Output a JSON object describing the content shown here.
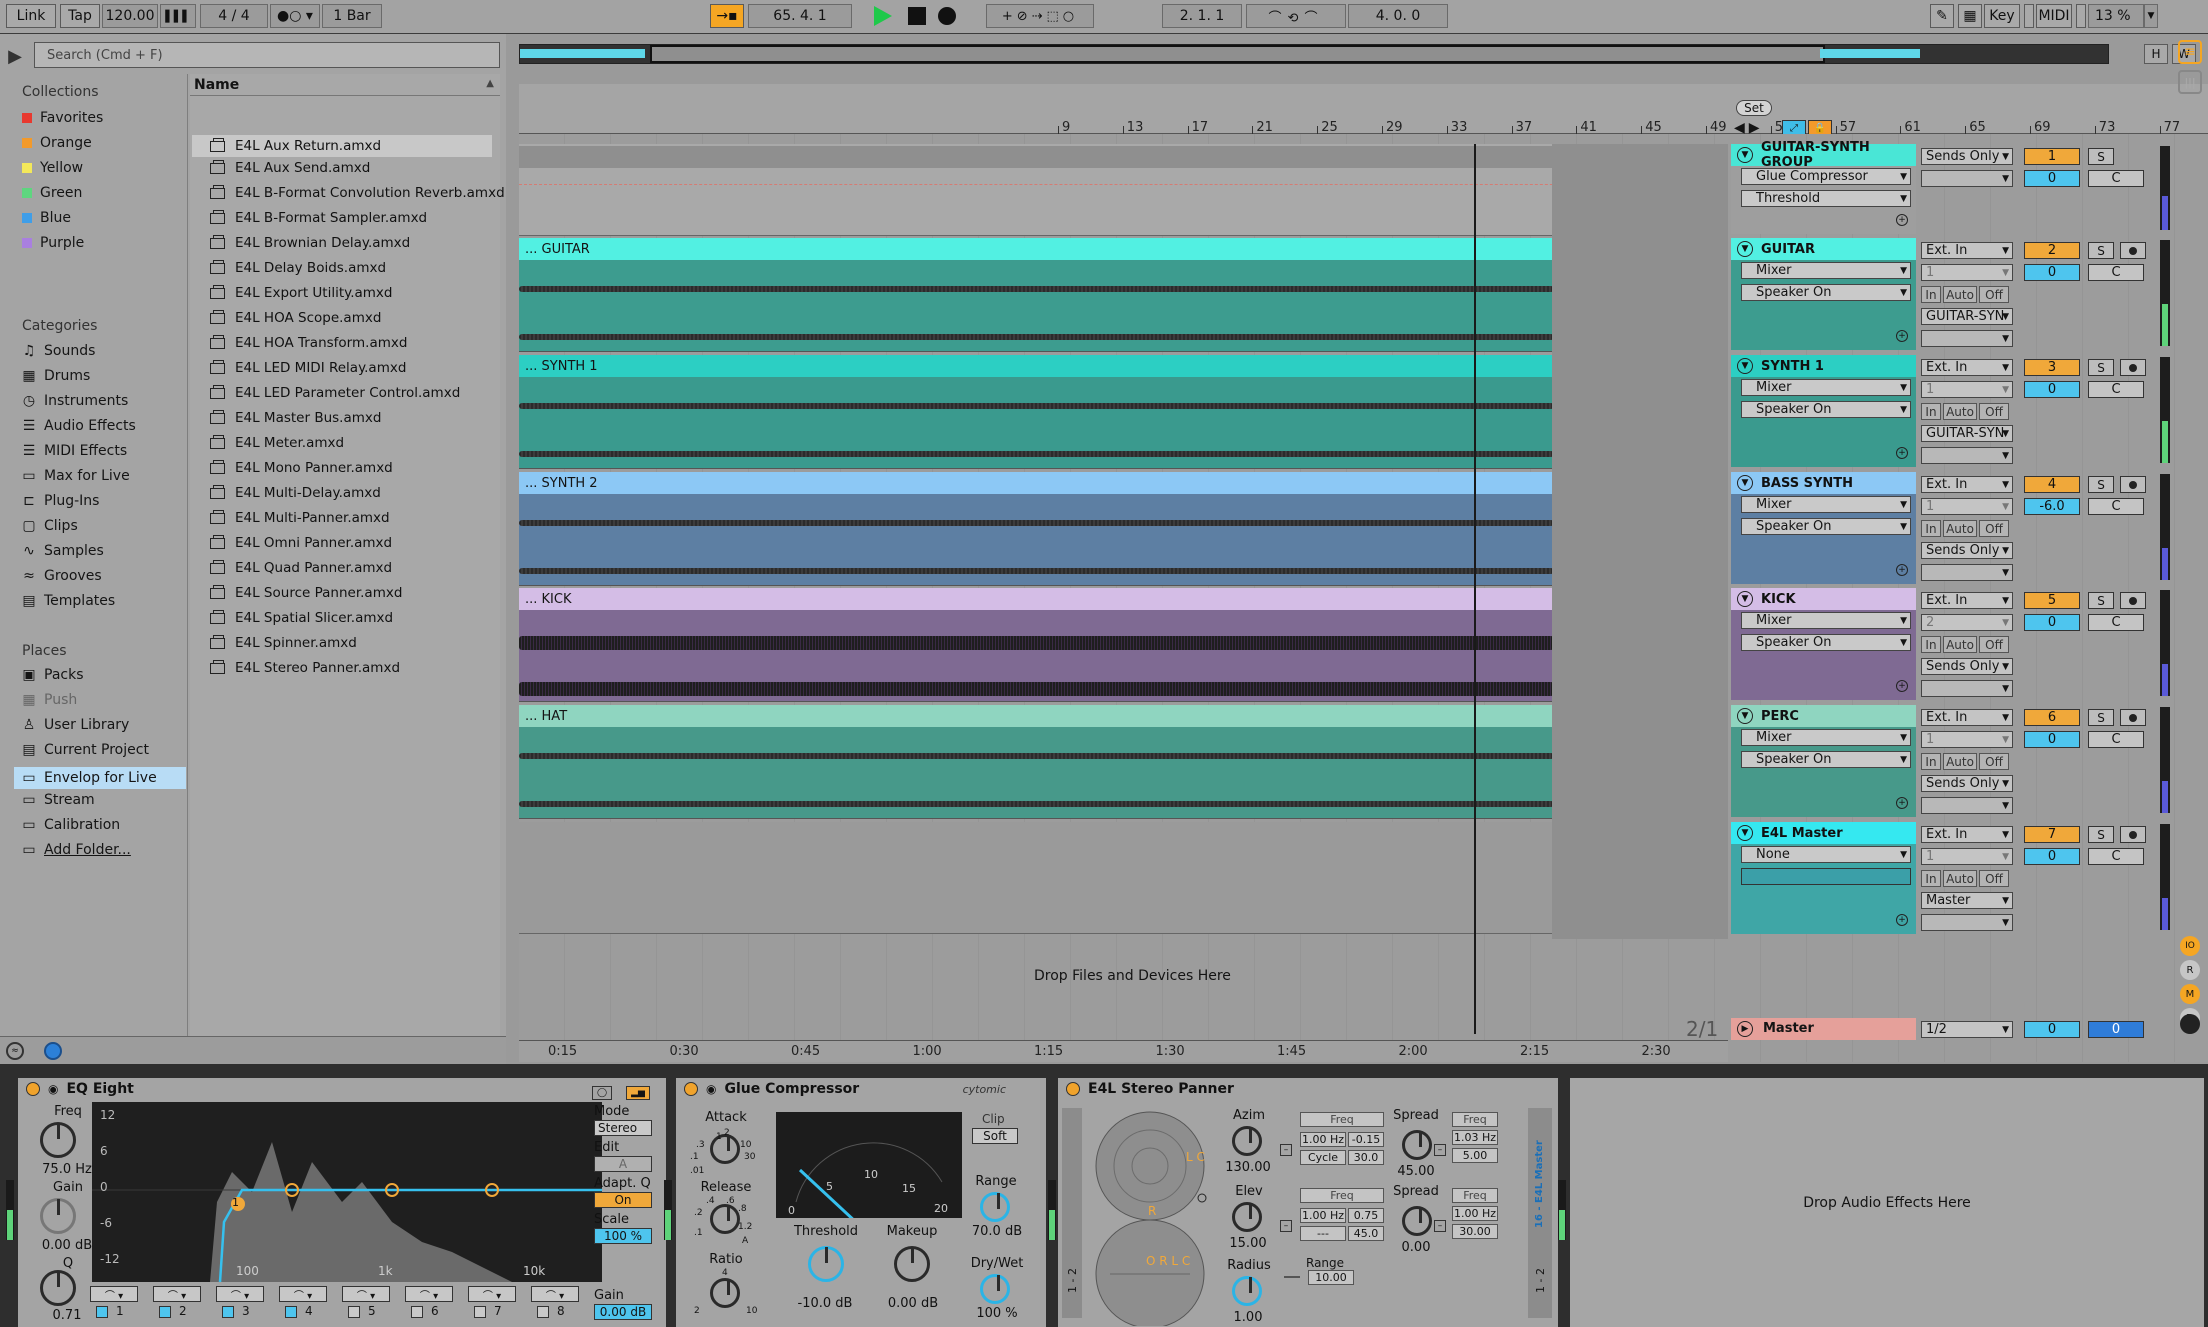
{
  "transport": {
    "link": "Link",
    "tap": "Tap",
    "tempo": "120.00",
    "signature": "4 / 4",
    "quantize": "1 Bar",
    "position": "65.  4.  1",
    "loop_start": "2.  1.  1",
    "loop_length": "4.  0.  0",
    "key": "Key",
    "midi": "MIDI",
    "cpu": "13 %"
  },
  "browser": {
    "search_placeholder": "Search (Cmd + F)",
    "collections_title": "Collections",
    "collections": [
      {
        "label": "Favorites",
        "color": "#e8392f"
      },
      {
        "label": "Orange",
        "color": "#f39a2b"
      },
      {
        "label": "Yellow",
        "color": "#f3e85a"
      },
      {
        "label": "Green",
        "color": "#5ed67f"
      },
      {
        "label": "Blue",
        "color": "#3f9ee8"
      },
      {
        "label": "Purple",
        "color": "#a97fe0"
      }
    ],
    "categories_title": "Categories",
    "categories": [
      {
        "label": "Sounds",
        "icon": "music-note-icon"
      },
      {
        "label": "Drums",
        "icon": "drum-grid-icon"
      },
      {
        "label": "Instruments",
        "icon": "clock-icon"
      },
      {
        "label": "Audio Effects",
        "icon": "sliders-icon"
      },
      {
        "label": "MIDI Effects",
        "icon": "sliders-icon"
      },
      {
        "label": "Max for Live",
        "icon": "m4l-icon"
      },
      {
        "label": "Plug-Ins",
        "icon": "plug-icon"
      },
      {
        "label": "Clips",
        "icon": "clip-icon"
      },
      {
        "label": "Samples",
        "icon": "wave-icon"
      },
      {
        "label": "Grooves",
        "icon": "groove-icon"
      },
      {
        "label": "Templates",
        "icon": "template-icon"
      }
    ],
    "places_title": "Places",
    "places": [
      {
        "label": "Packs",
        "icon": "package-icon"
      },
      {
        "label": "Push",
        "icon": "push-icon"
      },
      {
        "label": "User Library",
        "icon": "user-icon"
      },
      {
        "label": "Current Project",
        "icon": "project-icon"
      },
      {
        "label": "Envelop for Live",
        "icon": "folder-icon"
      },
      {
        "label": "Stream",
        "icon": "folder-icon"
      },
      {
        "label": "Calibration",
        "icon": "folder-icon"
      },
      {
        "label": "Add Folder...",
        "icon": "add-folder-icon"
      }
    ],
    "name_header": "Name",
    "files": [
      "E4L Aux Return.amxd",
      "E4L Aux Send.amxd",
      "E4L B-Format Convolution Reverb.amxd",
      "E4L B-Format Sampler.amxd",
      "E4L Brownian Delay.amxd",
      "E4L Delay Boids.amxd",
      "E4L Export Utility.amxd",
      "E4L HOA Scope.amxd",
      "E4L HOA Transform.amxd",
      "E4L LED MIDI Relay.amxd",
      "E4L LED Parameter Control.amxd",
      "E4L Master Bus.amxd",
      "E4L Meter.amxd",
      "E4L Mono Panner.amxd",
      "E4L Multi-Delay.amxd",
      "E4L Multi-Panner.amxd",
      "E4L Omni Panner.amxd",
      "E4L Quad Panner.amxd",
      "E4L Source Panner.amxd",
      "E4L Spatial Slicer.amxd",
      "E4L Spinner.amxd",
      "E4L Stereo Panner.amxd"
    ]
  },
  "arrangement": {
    "bar_ticks": [
      "9",
      "13",
      "17",
      "21",
      "25",
      "29",
      "33",
      "37",
      "41",
      "45",
      "49",
      "53",
      "57",
      "61",
      "65",
      "69",
      "73",
      "77"
    ],
    "time_ticks": [
      "0:15",
      "0:30",
      "0:45",
      "1:00",
      "1:15",
      "1:30",
      "1:45",
      "2:00",
      "2:15",
      "2:30"
    ],
    "set_label": "Set",
    "drop_label": "Drop Files and Devices Here",
    "page_indicator": "2/1",
    "h_btn": "H",
    "w_btn": "W"
  },
  "tracks": [
    {
      "clip": "",
      "name": "GUITAR-SYNTH GROUP",
      "color": "#49e6d6",
      "body": "#a8a8a8",
      "dd1": "Glue Compressor",
      "dd2": "Threshold",
      "io1": "Sends Only",
      "num": "1",
      "vol": "0",
      "pan": "C",
      "group": true
    },
    {
      "clip": "... GUITAR",
      "name": "GUITAR",
      "color": "#52f0e2",
      "body": "#3d9c8f",
      "dd1": "Mixer",
      "dd2": "Speaker On",
      "io1": "Ext. In",
      "io2": "1",
      "io3": "GUITAR-SYN",
      "num": "2",
      "vol": "0",
      "pan": "C"
    },
    {
      "clip": "... SYNTH 1",
      "name": "SYNTH 1",
      "color": "#2ccfc3",
      "body": "#3a9a8e",
      "dd1": "Mixer",
      "dd2": "Speaker On",
      "io1": "Ext. In",
      "io2": "1",
      "io3": "GUITAR-SYN",
      "num": "3",
      "vol": "0",
      "pan": "C"
    },
    {
      "clip": "... SYNTH 2",
      "name": "BASS SYNTH",
      "color": "#8cc8f5",
      "body": "#5d7fa3",
      "dd1": "Mixer",
      "dd2": "Speaker On",
      "io1": "Ext. In",
      "io2": "1",
      "io3": "Sends Only",
      "num": "4",
      "vol": "-6.0",
      "pan": "C"
    },
    {
      "clip": "... KICK",
      "name": "KICK",
      "color": "#d4bde6",
      "body": "#7f6a93",
      "dd1": "Mixer",
      "dd2": "Speaker On",
      "io1": "Ext. In",
      "io2": "2",
      "io3": "Sends Only",
      "num": "5",
      "vol": "0",
      "pan": "C"
    },
    {
      "clip": "... HAT",
      "name": "PERC",
      "color": "#8fd5c0",
      "body": "#47998a",
      "dd1": "Mixer",
      "dd2": "Speaker On",
      "io1": "Ext. In",
      "io2": "1",
      "io3": "Sends Only",
      "num": "6",
      "vol": "0",
      "pan": "C"
    },
    {
      "clip": "",
      "name": "E4L Master",
      "color": "#35e8f0",
      "body": "#a0a0a0",
      "dd1": "None",
      "dd2": "",
      "io1": "Ext. In",
      "io2": "1",
      "io3": "Master",
      "num": "7",
      "vol": "0",
      "pan": "C"
    }
  ],
  "mixer_small": {
    "in": "In",
    "auto": "Auto",
    "off": "Off",
    "solo": "S"
  },
  "master": {
    "name": "Master",
    "io": "1/2",
    "vol": "0",
    "pan": "0"
  },
  "eq_eight": {
    "title": "EQ Eight",
    "y_ticks": [
      "12",
      "6",
      "0",
      "-6",
      "-12"
    ],
    "x_ticks": [
      "100",
      "1k",
      "10k"
    ],
    "freq_label": "Freq",
    "freq_value": "75.0 Hz",
    "gain_label": "Gain",
    "gain_value": "0.00 dB",
    "q_label": "Q",
    "q_value": "0.71",
    "mode_label": "Mode",
    "mode_value": "Stereo",
    "edit_label": "Edit",
    "edit_value": "A",
    "adaptq_label": "Adapt. Q",
    "adaptq_value": "On",
    "scale_label": "Scale",
    "scale_value": "100 %",
    "gain2_label": "Gain",
    "gain2_value": "0.00 dB",
    "bands": [
      "1",
      "2",
      "3",
      "4",
      "5",
      "6",
      "7",
      "8"
    ],
    "band_marker": "1"
  },
  "glue": {
    "title": "Glue Compressor",
    "brand": "cytomic",
    "attack_label": "Attack",
    "attack_ticks": [
      "1",
      "2",
      ".3",
      "10",
      ".1",
      "30",
      ".01"
    ],
    "release_label": "Release",
    "release_ticks": [
      ".4",
      ".6",
      ".8",
      ".2",
      "1.2",
      ".1",
      "A"
    ],
    "ratio_label": "Ratio",
    "ratio_ticks": [
      "4",
      "2",
      "10"
    ],
    "meter_ticks": [
      "0",
      "5",
      "10",
      "15",
      "20"
    ],
    "threshold_label": "Threshold",
    "threshold_value": "-10.0 dB",
    "makeup_label": "Makeup",
    "makeup_value": "0.00 dB",
    "clip_label": "Clip",
    "soft_label": "Soft",
    "range_label": "Range",
    "range_value": "70.0 dB",
    "drywet_label": "Dry/Wet",
    "drywet_value": "100 %"
  },
  "panner": {
    "title": "E4L Stereo Panner",
    "azim_label": "Azim",
    "azim_value": "130.00",
    "elev_label": "Elev",
    "elev_value": "15.00",
    "radius_label": "Radius",
    "radius_value": "1.00",
    "freq_label": "Freq",
    "f1": "1.00 Hz",
    "f1b": "-0.15",
    "cycle_label": "Cycle",
    "cycle_value": "30.0",
    "f2": "1.00 Hz",
    "f2b": "0.75",
    "f2c": "---",
    "f2d": "45.0",
    "spread_label": "Spread",
    "spread1": "45.00",
    "spread2": "0.00",
    "sfreq1": "1.03 Hz",
    "sfreq1b": "5.00",
    "sfreq2": "1.00 Hz",
    "sfreq2b": "30.00",
    "range_label": "Range",
    "range_value": "10.00",
    "side_label": "16 - E4L Master",
    "side_io": "1 - 2",
    "lc": "L C",
    "r": "R",
    "orlc": "O R L C"
  },
  "drop_effects": "Drop Audio Effects Here"
}
